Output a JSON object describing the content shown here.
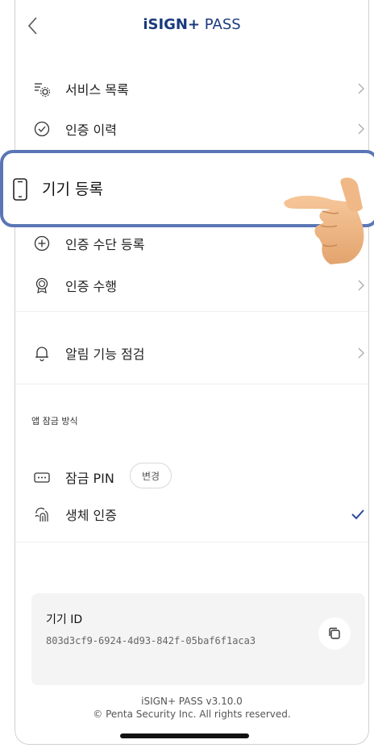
{
  "header": {
    "title_bold": "iSIGN+",
    "title_light": " PASS"
  },
  "menu": [
    {
      "label": "서비스 목록",
      "icon": "service-list-icon",
      "chevron": true
    },
    {
      "label": "인증 이력",
      "icon": "check-circle-icon",
      "chevron": true
    },
    {
      "label": "기기 등록",
      "icon": "phone-icon",
      "chevron": false,
      "highlighted": true
    },
    {
      "label": "인증 수단 등록",
      "icon": "plus-circle-icon",
      "chevron": false
    },
    {
      "label": "인증 수행",
      "icon": "badge-icon",
      "chevron": true
    },
    {
      "label": "알림 기능 점검",
      "icon": "bell-icon",
      "chevron": true
    }
  ],
  "lock_section": {
    "title": "앱 잠금 방식",
    "pin_label": "잠금 PIN",
    "pin_change": "변경",
    "bio_label": "생체 인증",
    "bio_checked": true
  },
  "device": {
    "label": "기기 ID",
    "id": "803d3cf9-6924-4d93-842f-05baf6f1aca3"
  },
  "footer": {
    "version": "iSIGN+ PASS v3.10.0",
    "copyright": "© Penta Security Inc. All rights reserved."
  },
  "colors": {
    "brand": "#1a3a7e",
    "highlight_border": "#5b76b5",
    "check": "#2b4a9a"
  }
}
